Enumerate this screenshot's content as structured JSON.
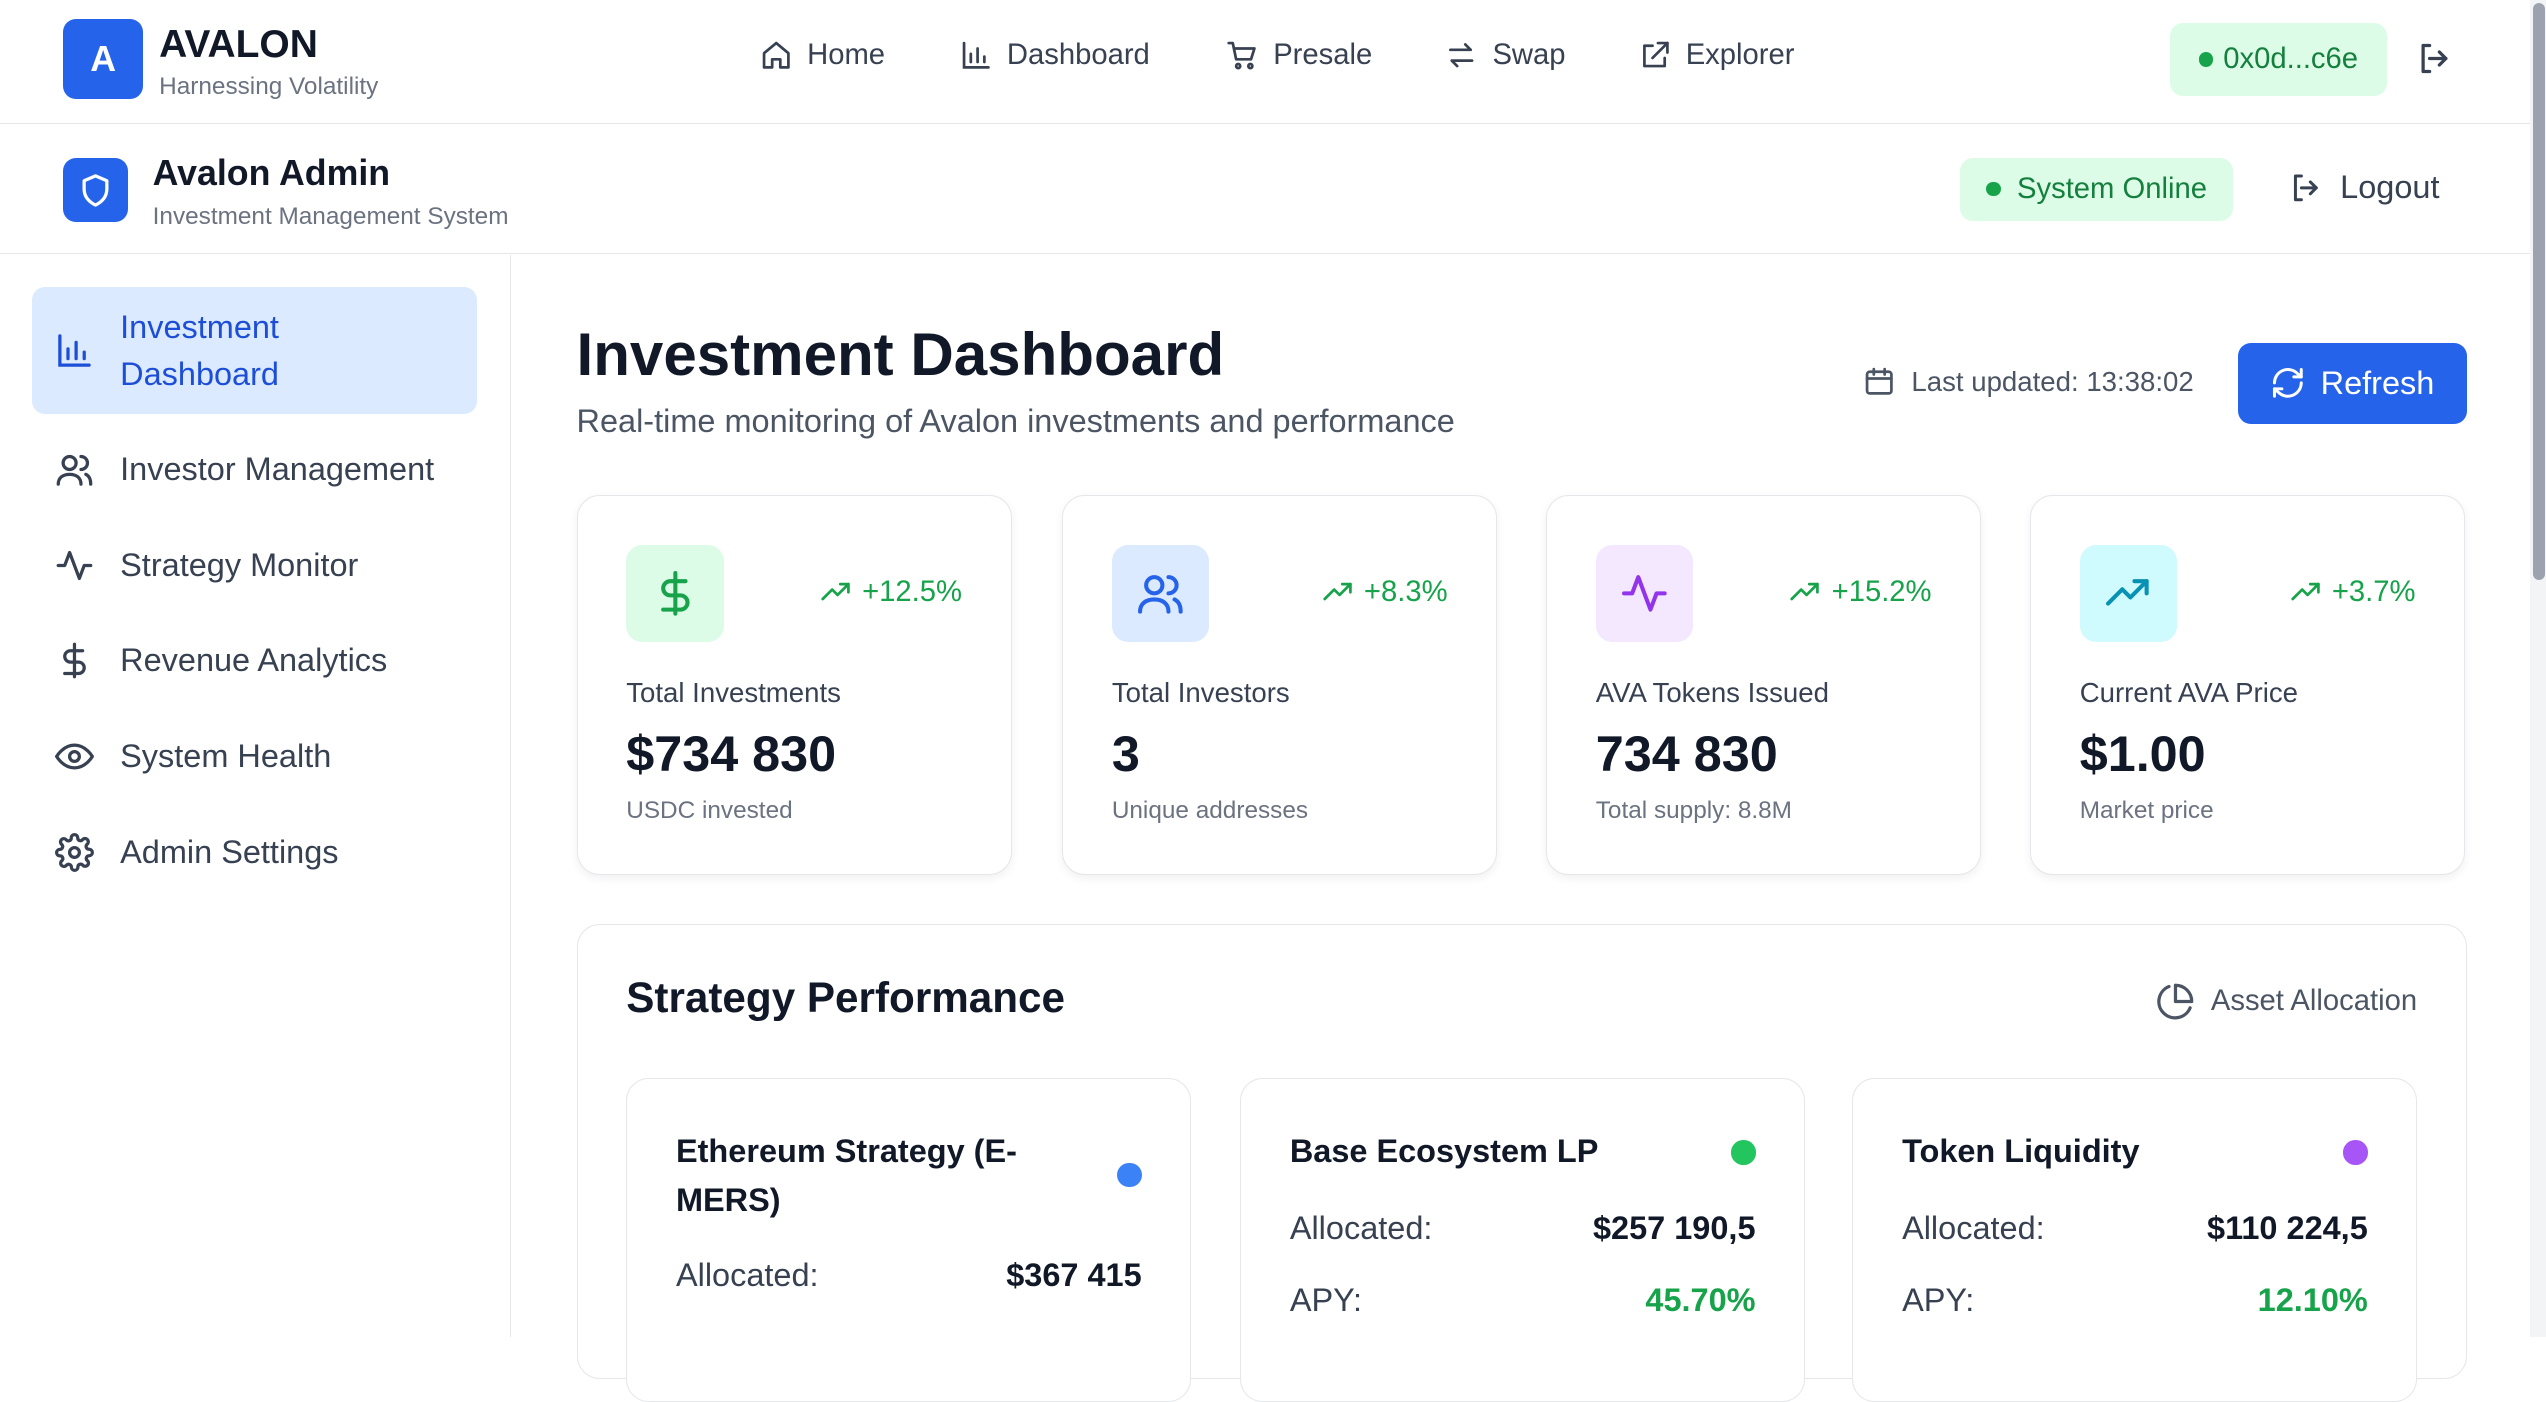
{
  "brand": {
    "logo_letter": "A",
    "name": "AVALON",
    "tagline": "Harnessing Volatility"
  },
  "nav": {
    "items": [
      {
        "label": "Home",
        "icon": "home-icon"
      },
      {
        "label": "Dashboard",
        "icon": "bar-chart-icon"
      },
      {
        "label": "Presale",
        "icon": "cart-icon"
      },
      {
        "label": "Swap",
        "icon": "swap-icon"
      },
      {
        "label": "Explorer",
        "icon": "external-link-icon"
      }
    ],
    "wallet": "0x0d...c6e"
  },
  "admin": {
    "title": "Avalon Admin",
    "subtitle": "Investment Management System",
    "status": "System Online",
    "logout": "Logout"
  },
  "sidebar": {
    "items": [
      {
        "label": "Investment Dashboard",
        "icon": "bar-chart-icon",
        "active": true
      },
      {
        "label": "Investor Management",
        "icon": "users-icon"
      },
      {
        "label": "Strategy Monitor",
        "icon": "activity-icon"
      },
      {
        "label": "Revenue Analytics",
        "icon": "dollar-icon"
      },
      {
        "label": "System Health",
        "icon": "eye-icon"
      },
      {
        "label": "Admin Settings",
        "icon": "gear-icon"
      }
    ]
  },
  "main": {
    "title": "Investment Dashboard",
    "subtitle": "Real-time monitoring of Avalon investments and performance",
    "last_updated": "Last updated: 13:38:02",
    "refresh": "Refresh"
  },
  "stats": [
    {
      "label": "Total Investments",
      "value": "$734 830",
      "note": "USDC invested",
      "change": "+12.5%",
      "icon": "dollar-icon",
      "icon_bg": "#dcfce7",
      "icon_color": "#16a34a"
    },
    {
      "label": "Total Investors",
      "value": "3",
      "note": "Unique addresses",
      "change": "+8.3%",
      "icon": "users-icon",
      "icon_bg": "#dbeafe",
      "icon_color": "#2563eb"
    },
    {
      "label": "AVA Tokens Issued",
      "value": "734 830",
      "note": "Total supply: 8.8M",
      "change": "+15.2%",
      "icon": "activity-icon",
      "icon_bg": "#f3e8ff",
      "icon_color": "#9333ea"
    },
    {
      "label": "Current AVA Price",
      "value": "$1.00",
      "note": "Market price",
      "change": "+3.7%",
      "icon": "trending-up-icon",
      "icon_bg": "#cffafe",
      "icon_color": "#0891b2"
    }
  ],
  "performance": {
    "title": "Strategy Performance",
    "asset_allocation": "Asset Allocation",
    "strategies": [
      {
        "name": "Ethereum Strategy (E-MERS)",
        "color": "#3b82f6",
        "allocated_label": "Allocated:",
        "allocated": "$367 415"
      },
      {
        "name": "Base Ecosystem LP",
        "color": "#22c55e",
        "allocated_label": "Allocated:",
        "allocated": "$257 190,5",
        "apy_label": "APY:",
        "apy": "45.70%"
      },
      {
        "name": "Token Liquidity",
        "color": "#a855f7",
        "allocated_label": "Allocated:",
        "allocated": "$110 224,5",
        "apy_label": "APY:",
        "apy": "12.10%"
      }
    ]
  }
}
